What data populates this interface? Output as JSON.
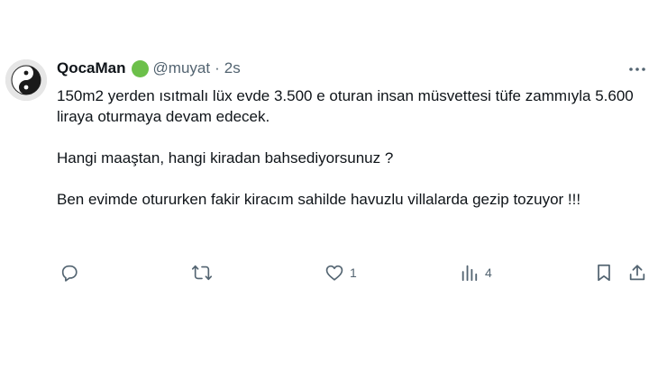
{
  "tweet": {
    "author": {
      "name": "QocaMan",
      "handle": "@muyat",
      "verified_color": "#6cc04a",
      "avatar": "yin-yang-avatar"
    },
    "separator": "·",
    "time": "2s",
    "paragraphs": [
      "150m2 yerden ısıtmalı lüx evde 3.500 e oturan insan müsvettesi tüfe zammıyla 5.600 liraya oturmaya devam edecek.",
      "Hangi maaştan, hangi kiradan bahsediyorsunuz ?",
      "Ben evimde otururken fakir kiracım sahilde havuzlu villalarda gezip tozuyor !!!"
    ],
    "actions": {
      "reply": {
        "icon": "reply-icon",
        "count": ""
      },
      "retweet": {
        "icon": "retweet-icon",
        "count": ""
      },
      "like": {
        "icon": "heart-icon",
        "count": "1"
      },
      "views": {
        "icon": "views-icon",
        "count": "4"
      },
      "bookmark": {
        "icon": "bookmark-icon"
      },
      "share": {
        "icon": "share-icon"
      }
    },
    "more_icon": "more-icon"
  },
  "colors": {
    "text": "#0f1419",
    "muted": "#536471",
    "background": "#ffffff"
  }
}
